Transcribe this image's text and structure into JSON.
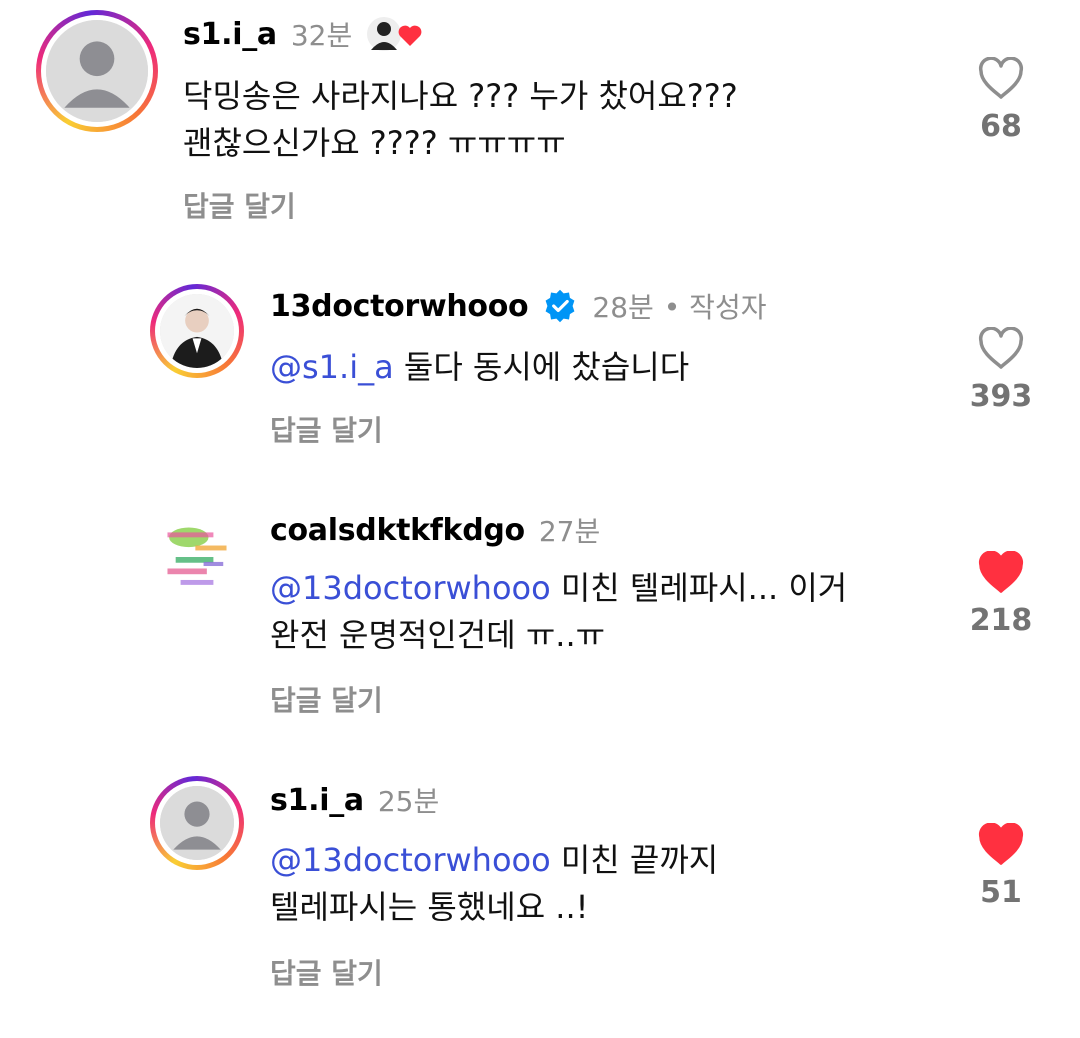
{
  "comments": [
    {
      "username": "s1.i_a",
      "time": "32분",
      "lines": [
        "닥밍송은 사라지나요 ??? 누가 찼어요???",
        "괜찮으신가요 ???? ㅠㅠㅠㅠ"
      ],
      "reply_label": "답글 달기",
      "likes": "68",
      "liked": false
    },
    {
      "username": "13doctorwhooo",
      "time": "28분",
      "author_tag": "• 작성자",
      "mention": "@s1.i_a",
      "lines": [
        " 둘다 동시에 찼습니다"
      ],
      "reply_label": "답글 달기",
      "likes": "393",
      "liked": false
    },
    {
      "username": "coalsdktkfkdgo",
      "time": "27분",
      "mention": "@13doctorwhooo",
      "lines": [
        " 미친 텔레파시... 이거",
        "완전 운명적인건데 ㅠ..ㅠ"
      ],
      "reply_label": "답글 달기",
      "likes": "218",
      "liked": true
    },
    {
      "username": "s1.i_a",
      "time": "25분",
      "mention": "@13doctorwhooo",
      "lines": [
        " 미친 끝까지",
        "텔레파시는 통했네요 ..!"
      ],
      "reply_label": "답글 달기",
      "likes": "51",
      "liked": true
    }
  ],
  "colors": {
    "mention": "#3a4fd6",
    "like_red": "#ff3040",
    "muted": "#8e8e8e",
    "verified": "#0095f6"
  },
  "icons": {
    "like": "heart-icon",
    "verified": "verified-badge-icon",
    "mention_prefix": "threads-at-icon"
  }
}
